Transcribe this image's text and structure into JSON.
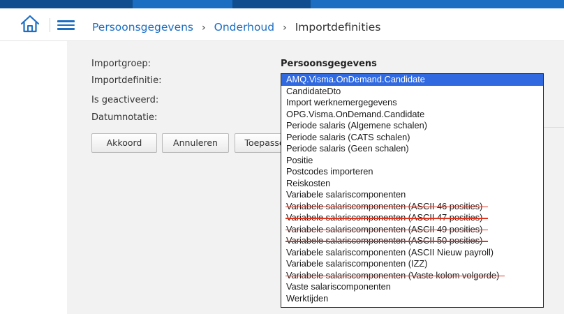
{
  "header": {
    "breadcrumb": {
      "level1": "Persoonsgegevens",
      "separator1": "›",
      "level2": "Onderhoud",
      "separator2": "›",
      "current": "Importdefinities"
    }
  },
  "form": {
    "importgroep_label": "Importgroep:",
    "importgroep_value": "Persoonsgegevens",
    "importdefinitie_label": "Importdefinitie:",
    "geactiveerd_label": "Is geactiveerd:",
    "datumnotatie_label": "Datumnotatie:"
  },
  "buttons": {
    "akkoord": "Akkoord",
    "annuleren": "Annuleren",
    "toepassen": "Toepassen"
  },
  "dropdown": {
    "options": [
      {
        "label": "AMQ.Visma.OnDemand.Candidate",
        "selected": true,
        "struck": false
      },
      {
        "label": "CandidateDto",
        "selected": false,
        "struck": false
      },
      {
        "label": "Import werknemergegevens",
        "selected": false,
        "struck": false
      },
      {
        "label": "OPG.Visma.OnDemand.Candidate",
        "selected": false,
        "struck": false
      },
      {
        "label": "Periode salaris (Algemene schalen)",
        "selected": false,
        "struck": false
      },
      {
        "label": "Periode salaris (CATS schalen)",
        "selected": false,
        "struck": false
      },
      {
        "label": "Periode salaris (Geen schalen)",
        "selected": false,
        "struck": false
      },
      {
        "label": "Positie",
        "selected": false,
        "struck": false
      },
      {
        "label": "Postcodes importeren",
        "selected": false,
        "struck": false
      },
      {
        "label": "Reiskosten",
        "selected": false,
        "struck": false
      },
      {
        "label": "Variabele salariscomponenten",
        "selected": false,
        "struck": false
      },
      {
        "label": "Variabele salariscomponenten (ASCII 46 posities)",
        "selected": false,
        "struck": true
      },
      {
        "label": "Variabele salariscomponenten (ASCII 47 posities)",
        "selected": false,
        "struck": true
      },
      {
        "label": "Variabele salariscomponenten (ASCII 49 posities)",
        "selected": false,
        "struck": true
      },
      {
        "label": "Variabele salariscomponenten (ASCII 50 posities)",
        "selected": false,
        "struck": true
      },
      {
        "label": "Variabele salariscomponenten (ASCII Nieuw payroll)",
        "selected": false,
        "struck": false
      },
      {
        "label": "Variabele salariscomponenten (IZZ)",
        "selected": false,
        "struck": false
      },
      {
        "label": "Variabele salariscomponenten (Vaste kolom volgorde)",
        "selected": false,
        "struck": true
      },
      {
        "label": "Vaste salariscomponenten",
        "selected": false,
        "struck": false
      },
      {
        "label": "Werktijden",
        "selected": false,
        "struck": false
      }
    ]
  },
  "colors": {
    "accent": "#1b6ec2",
    "selection": "#3069e0",
    "strike": "#e0341f",
    "content_bg": "#f2f2f2"
  },
  "icons": {
    "home": "home-icon",
    "menu": "hamburger-menu-icon"
  }
}
